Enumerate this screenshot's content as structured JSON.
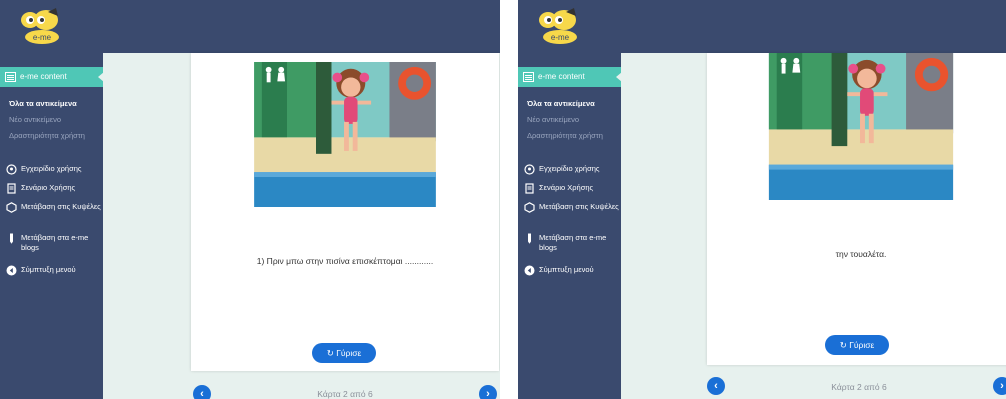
{
  "brand": {
    "logo_text": "e-me"
  },
  "sidebar": {
    "section_title": "e-me content",
    "sub_items": [
      {
        "label": "Όλα τα αντικείμενα",
        "active": true
      },
      {
        "label": "Νέο αντικείμενο",
        "active": false
      },
      {
        "label": "Δραστηριότητα χρήστη",
        "active": false
      }
    ],
    "menu_items": [
      {
        "label": "Εγχειρίδιο χρήσης",
        "icon": "help-icon"
      },
      {
        "label": "Σενάριο Χρήσης",
        "icon": "document-icon"
      },
      {
        "label": "Μετάβαση στις Κυψέλες",
        "icon": "hexagon-icon"
      },
      {
        "label": "Μετάβαση στα e-me blogs",
        "icon": "pencil-icon"
      },
      {
        "label": "Σύμπτυξη μενού",
        "icon": "collapse-icon"
      }
    ]
  },
  "panels": [
    {
      "card_text": "1) Πριν μπω στην πισίνα επισκέπτομαι ............",
      "flip_label": "Γύρισε",
      "counter": "Κάρτα 2 από 6"
    },
    {
      "card_text": "την τουαλέτα.",
      "flip_label": "Γύρισε",
      "counter": "Κάρτα 2 από 6"
    }
  ],
  "colors": {
    "header": "#3a4a6e",
    "accent": "#4fc7b6",
    "button": "#1a6fd6",
    "background": "#e7f1ee"
  }
}
